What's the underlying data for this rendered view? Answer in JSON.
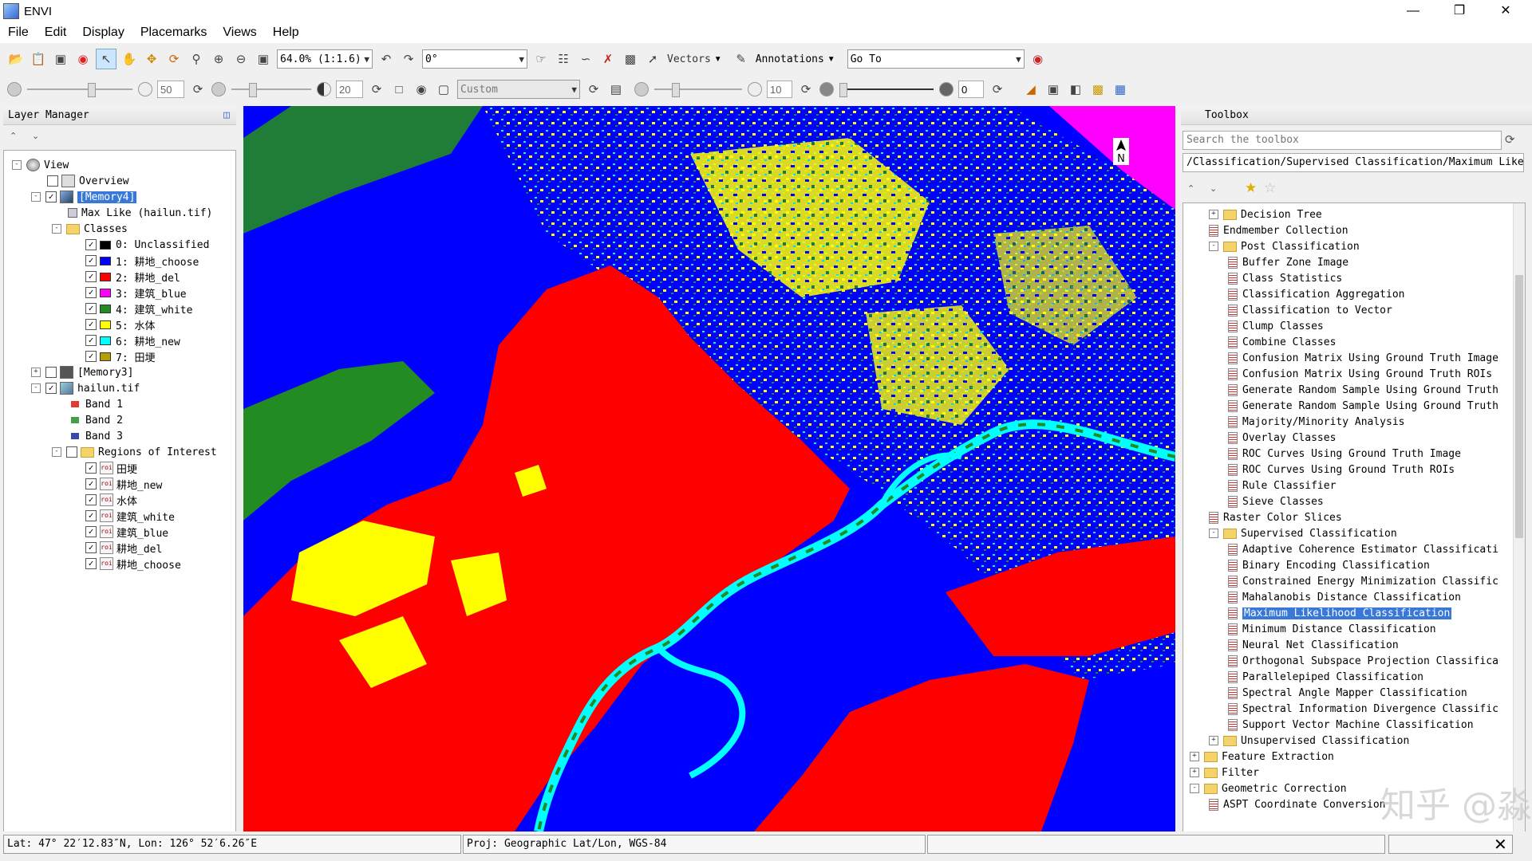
{
  "window": {
    "title": "ENVI"
  },
  "menu": [
    "File",
    "Edit",
    "Display",
    "Placemarks",
    "Views",
    "Help"
  ],
  "toolbar1": {
    "zoom": "64.0% (1:1.6)",
    "rotation": "0°",
    "vectors_label": "Vectors",
    "annotations_label": "Annotations",
    "goto_value": "Go To"
  },
  "toolbar2": {
    "brightness": "50",
    "contrast": "20",
    "stretch": "Custom",
    "sharpen": "10",
    "transparency": "0"
  },
  "layer_manager": {
    "title": "Layer Manager",
    "view": "View",
    "overview": "Overview",
    "memory4": "[Memory4]",
    "maxlike": "Max Like (hailun.tif)",
    "classes_label": "Classes",
    "classes": [
      {
        "label": "0: Unclassified",
        "color": "#000000"
      },
      {
        "label": "1: 耕地_choose",
        "color": "#0000ff"
      },
      {
        "label": "2: 耕地_del",
        "color": "#ff0000"
      },
      {
        "label": "3: 建筑_blue",
        "color": "#ff00ff"
      },
      {
        "label": "4: 建筑_white",
        "color": "#228b22"
      },
      {
        "label": "5: 水体",
        "color": "#ffff00"
      },
      {
        "label": "6: 耕地_new",
        "color": "#00ffff"
      },
      {
        "label": "7: 田埂",
        "color": "#b3a000"
      }
    ],
    "memory3": "[Memory3]",
    "hailun": "hailun.tif",
    "bands": [
      {
        "label": "Band 1",
        "color": "#e53935"
      },
      {
        "label": "Band 2",
        "color": "#43a047"
      },
      {
        "label": "Band 3",
        "color": "#3949ab"
      }
    ],
    "roi_label": "Regions of Interest",
    "rois": [
      "田埂",
      "耕地_new",
      "水体",
      "建筑_white",
      "建筑_blue",
      "耕地_del",
      "耕地_choose"
    ]
  },
  "toolbox": {
    "title": "Toolbox",
    "search_placeholder": "Search the toolbox",
    "path": "/Classification/Supervised Classification/Maximum Likeli",
    "items": [
      {
        "level": 1,
        "type": "folder",
        "label": "Decision Tree",
        "exp": "+"
      },
      {
        "level": 1,
        "type": "tool",
        "label": "Endmember Collection"
      },
      {
        "level": 1,
        "type": "folder",
        "label": "Post Classification",
        "exp": "-"
      },
      {
        "level": 2,
        "type": "tool",
        "label": "Buffer Zone Image"
      },
      {
        "level": 2,
        "type": "tool",
        "label": "Class Statistics"
      },
      {
        "level": 2,
        "type": "tool",
        "label": "Classification Aggregation"
      },
      {
        "level": 2,
        "type": "tool",
        "label": "Classification to Vector"
      },
      {
        "level": 2,
        "type": "tool",
        "label": "Clump Classes"
      },
      {
        "level": 2,
        "type": "tool",
        "label": "Combine Classes"
      },
      {
        "level": 2,
        "type": "tool",
        "label": "Confusion Matrix Using Ground Truth Image"
      },
      {
        "level": 2,
        "type": "tool",
        "label": "Confusion Matrix Using Ground Truth ROIs"
      },
      {
        "level": 2,
        "type": "tool",
        "label": "Generate Random Sample Using Ground Truth"
      },
      {
        "level": 2,
        "type": "tool",
        "label": "Generate Random Sample Using Ground Truth"
      },
      {
        "level": 2,
        "type": "tool",
        "label": "Majority/Minority Analysis"
      },
      {
        "level": 2,
        "type": "tool",
        "label": "Overlay Classes"
      },
      {
        "level": 2,
        "type": "tool",
        "label": "ROC Curves Using Ground Truth Image"
      },
      {
        "level": 2,
        "type": "tool",
        "label": "ROC Curves Using Ground Truth ROIs"
      },
      {
        "level": 2,
        "type": "tool",
        "label": "Rule Classifier"
      },
      {
        "level": 2,
        "type": "tool",
        "label": "Sieve Classes"
      },
      {
        "level": 1,
        "type": "tool",
        "label": "Raster Color Slices"
      },
      {
        "level": 1,
        "type": "folder",
        "label": "Supervised Classification",
        "exp": "-"
      },
      {
        "level": 2,
        "type": "tool",
        "label": "Adaptive Coherence Estimator Classificati"
      },
      {
        "level": 2,
        "type": "tool",
        "label": "Binary Encoding Classification"
      },
      {
        "level": 2,
        "type": "tool",
        "label": "Constrained Energy Minimization Classific"
      },
      {
        "level": 2,
        "type": "tool",
        "label": "Mahalanobis Distance Classification"
      },
      {
        "level": 2,
        "type": "tool",
        "label": "Maximum Likelihood Classification",
        "selected": true
      },
      {
        "level": 2,
        "type": "tool",
        "label": "Minimum Distance Classification"
      },
      {
        "level": 2,
        "type": "tool",
        "label": "Neural Net Classification"
      },
      {
        "level": 2,
        "type": "tool",
        "label": "Orthogonal Subspace Projection Classifica"
      },
      {
        "level": 2,
        "type": "tool",
        "label": "Parallelepiped Classification"
      },
      {
        "level": 2,
        "type": "tool",
        "label": "Spectral Angle Mapper Classification"
      },
      {
        "level": 2,
        "type": "tool",
        "label": "Spectral Information Divergence Classific"
      },
      {
        "level": 2,
        "type": "tool",
        "label": "Support Vector Machine Classification"
      },
      {
        "level": 1,
        "type": "folder",
        "label": "Unsupervised Classification",
        "exp": "+"
      },
      {
        "level": 0,
        "type": "folder",
        "label": "Feature Extraction",
        "exp": "+"
      },
      {
        "level": 0,
        "type": "folder",
        "label": "Filter",
        "exp": "+"
      },
      {
        "level": 0,
        "type": "folder",
        "label": "Geometric Correction",
        "exp": "-"
      },
      {
        "level": 1,
        "type": "tool",
        "label": "ASPT Coordinate Conversion"
      }
    ]
  },
  "status": {
    "latlon": "Lat: 47° 22′12.83″N, Lon: 126° 52′6.26″E",
    "proj": "Proj: Geographic Lat/Lon, WGS-84"
  },
  "map": {
    "north_label": "N"
  },
  "watermark": "知乎 @淼淼"
}
